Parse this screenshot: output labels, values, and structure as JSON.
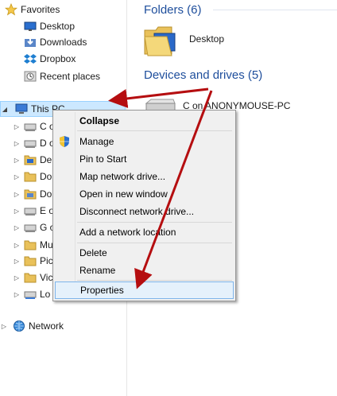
{
  "navigation": {
    "favorites": {
      "label": "Favorites",
      "items": [
        {
          "label": "Desktop",
          "icon": "desktop-icon"
        },
        {
          "label": "Downloads",
          "icon": "downloads-icon"
        },
        {
          "label": "Dropbox",
          "icon": "dropbox-icon"
        },
        {
          "label": "Recent places",
          "icon": "recent-places-icon"
        }
      ]
    },
    "this_pc": {
      "label": "This PC",
      "children": [
        {
          "label": "C o",
          "icon": "drive-icon"
        },
        {
          "label": "D o",
          "icon": "drive-icon"
        },
        {
          "label": "De",
          "icon": "desktop-folder-icon"
        },
        {
          "label": "Do",
          "icon": "documents-folder-icon"
        },
        {
          "label": "Do",
          "icon": "downloads-folder-icon"
        },
        {
          "label": "E o",
          "icon": "drive-icon"
        },
        {
          "label": "G o",
          "icon": "drive-icon"
        },
        {
          "label": "Mu",
          "icon": "music-folder-icon"
        },
        {
          "label": "Pic",
          "icon": "pictures-folder-icon"
        },
        {
          "label": "Vic",
          "icon": "videos-folder-icon"
        },
        {
          "label": "Lo",
          "icon": "local-disk-icon"
        }
      ]
    },
    "network": {
      "label": "Network"
    }
  },
  "content": {
    "folders_header": "Folders (6)",
    "folder_items": [
      {
        "label": "Desktop"
      }
    ],
    "devices_header": "Devices and drives (5)",
    "drive_items": [
      {
        "label": "C on ANONYMOUSE-PC"
      }
    ]
  },
  "context_menu": {
    "items": [
      {
        "label": "Collapse"
      },
      {
        "label": "Manage"
      },
      {
        "label": "Pin to Start"
      },
      {
        "label": "Map network drive..."
      },
      {
        "label": "Open in new window"
      },
      {
        "label": "Disconnect network drive..."
      },
      {
        "label": "Add a network location"
      },
      {
        "label": "Delete"
      },
      {
        "label": "Rename"
      },
      {
        "label": "Properties"
      }
    ]
  },
  "colors": {
    "arrow": "#b50e10",
    "header_blue": "#1e4e9c",
    "menu_highlight": "#e5f1fb",
    "menu_highlight_border": "#7eb4ea",
    "selected_row": "#cce8ff"
  }
}
